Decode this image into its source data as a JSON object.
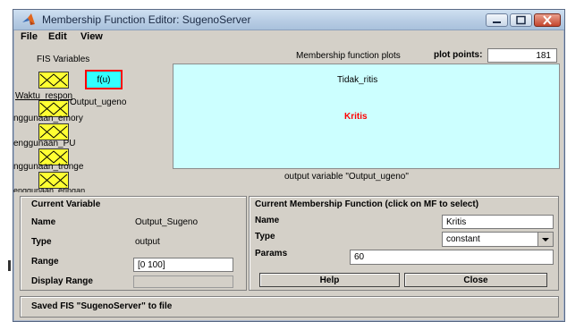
{
  "window": {
    "title": "Membership Function Editor: SugenoServer"
  },
  "menu": {
    "file": "File",
    "edit": "Edit",
    "view": "View"
  },
  "fis": {
    "heading": "FIS Variables",
    "output_box_label": "f(u)",
    "variables": [
      "Waktu_respon",
      "Output_ugeno",
      "nggunaan_emory",
      "enggunaan_PU",
      "nggunaan_tronge",
      "enggunaan_eringan"
    ]
  },
  "plot": {
    "heading": "Membership function plots",
    "points_label": "plot points:",
    "points_value": "181",
    "mf1": "Tidak_ritis",
    "mf2": "Kritis",
    "footer": "output variable \"Output_ugeno\"",
    "mf2_color": "#ff0000",
    "bg_color": "#ccffff"
  },
  "current_variable": {
    "heading": "Current Variable",
    "name_label": "Name",
    "name_value": "Output_Sugeno",
    "type_label": "Type",
    "type_value": "output",
    "range_label": "Range",
    "range_value": "[0 100]",
    "display_range_label": "Display Range",
    "display_range_value": ""
  },
  "current_mf": {
    "heading": "Current Membership Function (click on MF to select)",
    "name_label": "Name",
    "name_value": "Kritis",
    "type_label": "Type",
    "type_value": "constant",
    "params_label": "Params",
    "params_value": "60"
  },
  "buttons": {
    "help": "Help",
    "close": "Close"
  },
  "status": {
    "text": "Saved FIS \"SugenoServer\" to file"
  },
  "colors": {
    "highlight_border": "#ff0000",
    "fis_box": "#ffff33",
    "selected_output_box": "#33ffff"
  }
}
